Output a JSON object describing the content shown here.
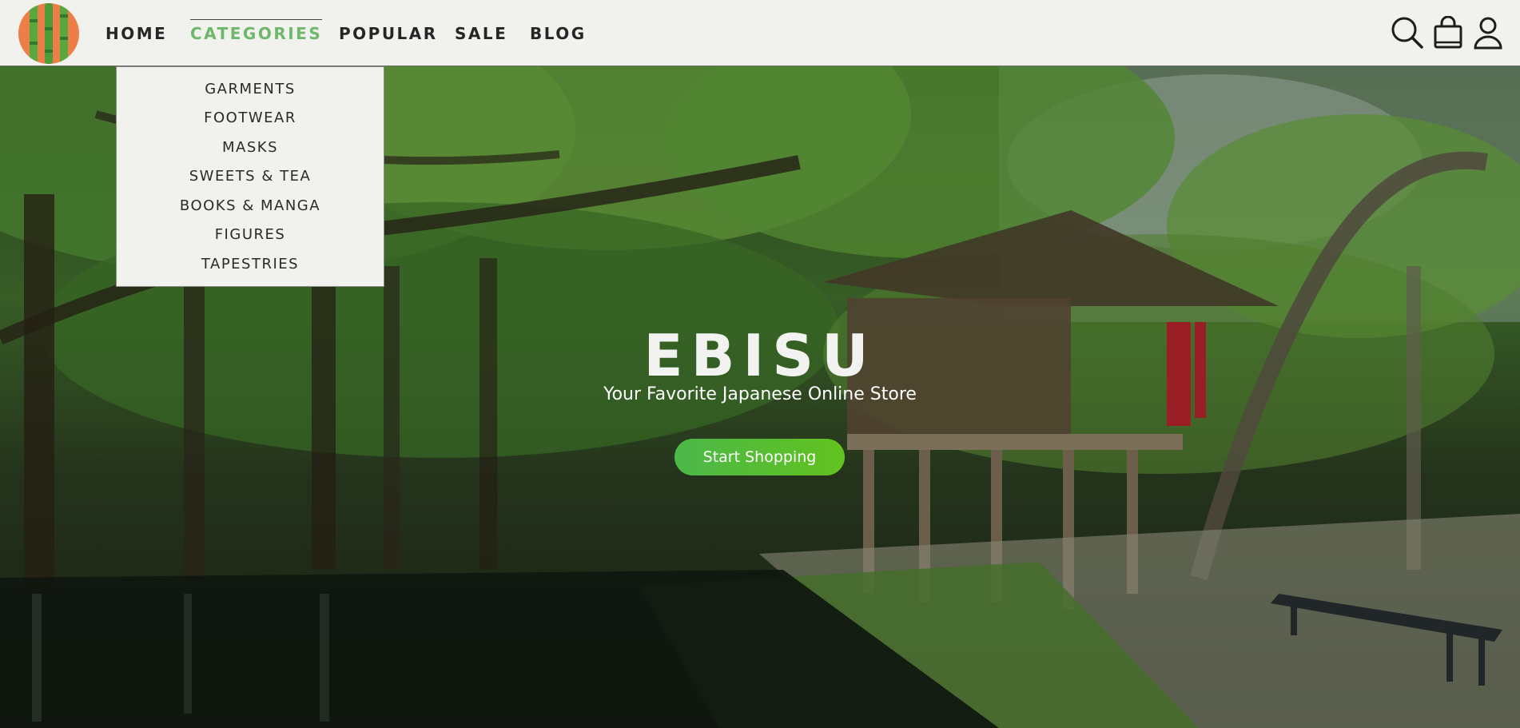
{
  "brand": {
    "logo_icon": "bamboo-logo-icon",
    "colors": {
      "logo_bg": "#ee7e47",
      "logo_bamboo": "#58a840",
      "accent": "#6db86a",
      "cta": "#4cb84a"
    }
  },
  "nav": {
    "items": [
      {
        "label": "HOME",
        "active": false
      },
      {
        "label": "CATEGORIES",
        "active": true
      },
      {
        "label": "POPULAR",
        "active": false
      },
      {
        "label": "SALE",
        "active": false
      },
      {
        "label": "BLOG",
        "active": false
      }
    ]
  },
  "header_icons": [
    "search-icon",
    "shopping-bag-icon",
    "user-icon"
  ],
  "dropdown": {
    "items": [
      "GARMENTS",
      "FOOTWEAR",
      "MASKS",
      "SWEETS & TEA",
      "BOOKS & MANGA",
      "FIGURES",
      "TAPESTRIES"
    ]
  },
  "hero": {
    "title": "EBISU",
    "subtitle": "Your Favorite Japanese Online Store",
    "cta_label": "Start Shopping"
  }
}
